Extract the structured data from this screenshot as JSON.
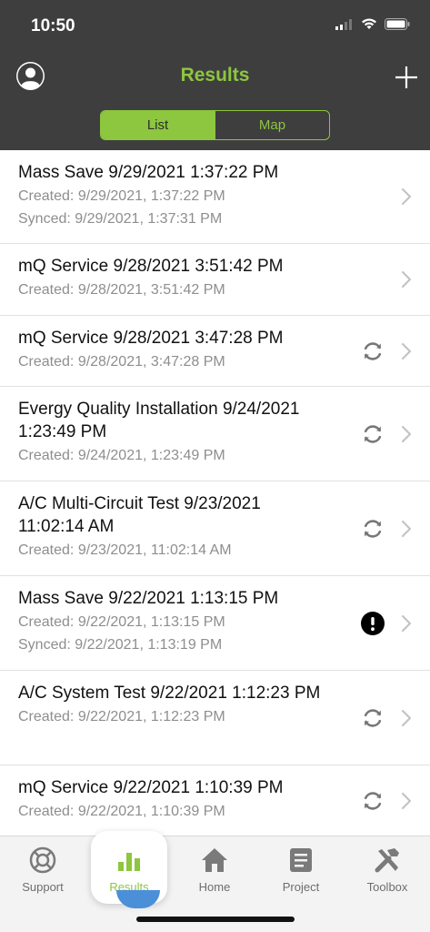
{
  "status_bar": {
    "time": "10:50"
  },
  "header": {
    "title": "Results"
  },
  "view_toggle": {
    "list_label": "List",
    "map_label": "Map",
    "selected": "List"
  },
  "results": [
    {
      "title": "Mass Save 9/29/2021 1:37:22 PM",
      "created": "Created: 9/29/2021, 1:37:22 PM",
      "synced": "Synced: 9/29/2021, 1:37:31 PM",
      "status_icon": ""
    },
    {
      "title": "mQ Service 9/28/2021 3:51:42 PM",
      "created": "Created: 9/28/2021, 3:51:42 PM",
      "synced": "",
      "status_icon": ""
    },
    {
      "title": "mQ Service 9/28/2021 3:47:28 PM",
      "created": "Created: 9/28/2021, 3:47:28 PM",
      "synced": "",
      "status_icon": "sync-icon"
    },
    {
      "title": "Evergy Quality Installation 9/24/2021 1:23:49 PM",
      "created": "Created: 9/24/2021, 1:23:49 PM",
      "synced": "",
      "status_icon": "sync-icon"
    },
    {
      "title": "A/C Multi-Circuit Test 9/23/2021 11:02:14 AM",
      "created": "Created: 9/23/2021, 11:02:14 AM",
      "synced": "",
      "status_icon": "sync-icon"
    },
    {
      "title": "Mass Save 9/22/2021 1:13:15 PM",
      "created": "Created: 9/22/2021, 1:13:15 PM",
      "synced": "Synced: 9/22/2021, 1:13:19 PM",
      "status_icon": "error-icon"
    },
    {
      "title": "A/C System Test 9/22/2021 1:12:23 PM",
      "created": "Created: 9/22/2021, 1:12:23 PM",
      "synced": "",
      "status_icon": "sync-icon"
    },
    {
      "title": "mQ Service 9/22/2021 1:10:39 PM",
      "created": "Created: 9/22/2021, 1:10:39 PM",
      "synced": "",
      "status_icon": "sync-icon"
    }
  ],
  "tab_bar": {
    "tabs": [
      {
        "label": "Support",
        "icon": "lifebuoy-icon"
      },
      {
        "label": "Results",
        "icon": "bar-chart-icon",
        "active": true
      },
      {
        "label": "Home",
        "icon": "home-icon"
      },
      {
        "label": "Project",
        "icon": "document-icon"
      },
      {
        "label": "Toolbox",
        "icon": "tools-icon"
      }
    ]
  },
  "colors": {
    "accent": "#8dc63f",
    "header_bg": "#3e3e3e",
    "error": "#000000"
  }
}
